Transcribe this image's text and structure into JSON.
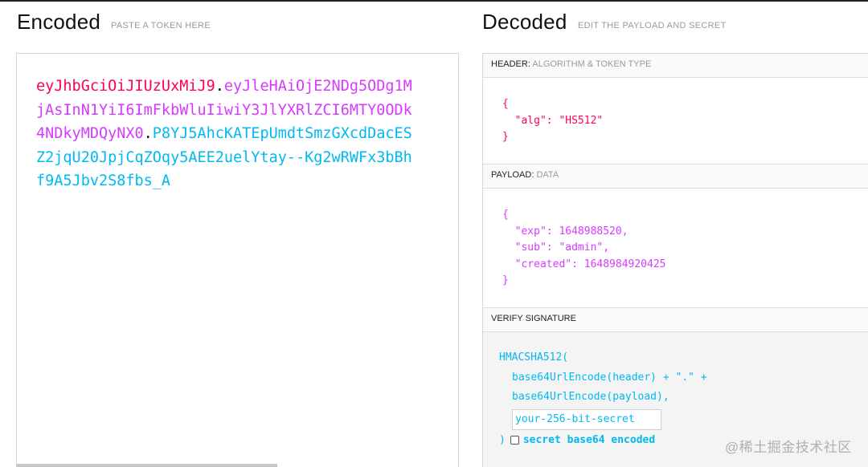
{
  "encoded": {
    "title": "Encoded",
    "subtitle": "PASTE A TOKEN HERE",
    "token_header": "eyJhbGciOiJIUzUxMiJ9",
    "dot1": ".",
    "token_payload": "eyJleHAiOjE2NDg5ODg1MjAsInN1YiI6ImFkbWluIiwiY3JlYXRlZCI6MTY0ODk4NDkyMDQyNX0",
    "dot2": ".",
    "token_signature": "P8YJ5AhcKATEpUmdtSmzGXcdDacESZ2jqU20JpjCqZOqy5AEE2uelYtay--Kg2wRWFx3bBhf9A5Jbv2S8fbs_A"
  },
  "decoded": {
    "title": "Decoded",
    "subtitle": "EDIT THE PAYLOAD AND SECRET",
    "header_section": {
      "label": "HEADER:",
      "sublabel": "ALGORITHM & TOKEN TYPE"
    },
    "header_json": "{\n  \"alg\": \"HS512\"\n}",
    "payload_section": {
      "label": "PAYLOAD:",
      "sublabel": "DATA"
    },
    "payload_json": "{\n  \"exp\": 1648988520,\n  \"sub\": \"admin\",\n  \"created\": 1648984920425\n}",
    "verify_section": {
      "label": "VERIFY SIGNATURE"
    },
    "verify": {
      "line1": "HMACSHA512(",
      "line2": "base64UrlEncode(header) + \".\" +",
      "line3": "base64UrlEncode(payload),",
      "secret_placeholder": "your-256-bit-secret",
      "close": ")",
      "checkbox_label": "secret base64 encoded"
    }
  },
  "watermark": "@稀土掘金技术社区",
  "colors": {
    "header": "#fb015b",
    "payload": "#d63aff",
    "signature": "#00b9f1"
  }
}
